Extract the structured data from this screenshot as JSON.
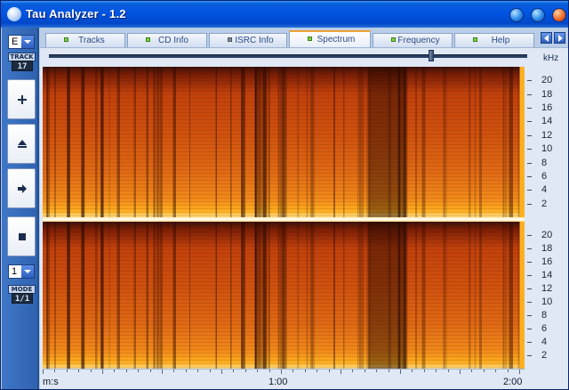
{
  "window": {
    "title": "Tau Analyzer - 1.2"
  },
  "left_panel": {
    "track_select_value": "E",
    "track_label": "TRACK",
    "track_number": "17",
    "mode_select_value": "1",
    "mode_label": "MODE",
    "mode_value": "1/1",
    "buttons": [
      {
        "name": "add-button",
        "icon": "plus-icon"
      },
      {
        "name": "eject-button",
        "icon": "eject-icon"
      },
      {
        "name": "play-button",
        "icon": "arrow-right-icon"
      },
      {
        "name": "stop-button",
        "icon": "stop-icon"
      }
    ]
  },
  "tabs": [
    {
      "label": "Tracks",
      "led": "green"
    },
    {
      "label": "CD Info",
      "led": "green"
    },
    {
      "label": "ISRC Info",
      "led": "gray"
    },
    {
      "label": "Spectrum",
      "led": "green",
      "active": true
    },
    {
      "label": "Frequency",
      "led": "green"
    },
    {
      "label": "Help",
      "led": "green"
    }
  ],
  "scroll": {
    "position": 0.8
  },
  "spectrum": {
    "unit_label": "kHz",
    "freq_ticks": [
      "20",
      "18",
      "16",
      "14",
      "12",
      "10",
      "8",
      "6",
      "4",
      "2"
    ],
    "time_axis_label": "m:s",
    "time_ticks": [
      "1:00",
      "2:00"
    ],
    "colors": {
      "dark": "#3a1208",
      "mid": "#c2410c",
      "bright": "#ffb020",
      "separator": "#fff2c8"
    }
  }
}
